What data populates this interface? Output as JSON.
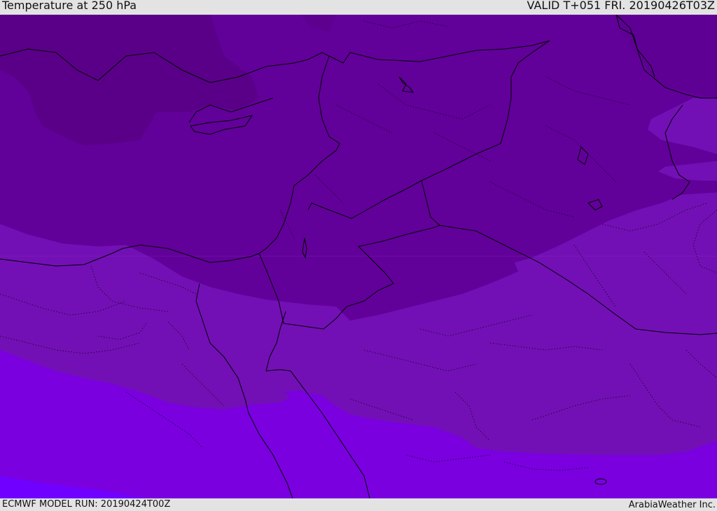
{
  "header": {
    "title": "Temperature at 250 hPa",
    "valid_time": "VALID T+051 FRI. 20190426T03Z"
  },
  "footer": {
    "model_run": "ECMWF MODEL RUN: 20190424T00Z",
    "credit": "ArabiaWeather Inc."
  },
  "colors": {
    "coldest": "#5a0088",
    "cold": "#62009a",
    "mid": "#6a00a8",
    "mild": "#7210b5",
    "warm": "#7a00e0",
    "warmest": "#7000ff",
    "border": "#000000"
  }
}
